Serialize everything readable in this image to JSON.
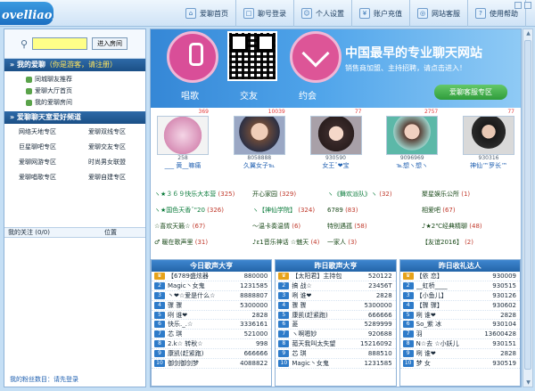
{
  "app": {
    "logo": "ovelliao爱聊"
  },
  "nav": [
    {
      "icon": "home-icon",
      "glyph": "⌂",
      "label": "爱聊首页"
    },
    {
      "icon": "login-icon",
      "glyph": "□",
      "label": "聊号登录"
    },
    {
      "icon": "user-settings-icon",
      "glyph": "☺",
      "label": "个人设置"
    },
    {
      "icon": "recharge-icon",
      "glyph": "¥",
      "label": "账户充值"
    },
    {
      "icon": "support-icon",
      "glyph": "◎",
      "label": "网站客服"
    },
    {
      "icon": "help-icon",
      "glyph": "?",
      "label": "使用帮助"
    }
  ],
  "search": {
    "button": "进入房间",
    "value": ""
  },
  "my_aichat": {
    "title": "我的爱聊",
    "hint": "（你是游客，请注册）",
    "items": [
      "同城聊友推荐",
      "爱聊大厅首页",
      "我的爱聊房间"
    ]
  },
  "channels": {
    "title": "爱聊聊天室爱好频道",
    "items": [
      "网络天地专区",
      "爱聊双线专区",
      "巨星聊吧专区",
      "爱聊交友专区",
      "爱聊网游专区",
      "时尚男女联盟",
      "爱聊唱歌专区",
      "爱聊自建专区"
    ]
  },
  "attention": {
    "label": "我的关注 (0/0)",
    "position": "位置"
  },
  "fans": "我的粉丝数目：请先登录",
  "banner": {
    "title": "中国最早的专业聊天网站",
    "subtitle": "销售商加盟、主持招聘，请点击进入！",
    "labels": [
      "唱歌",
      "交友",
      "约会"
    ],
    "button": "爱聊客服专区"
  },
  "cards": [
    {
      "num": "369",
      "id": "258",
      "nick": "___ 黄__嘛痛"
    },
    {
      "num": "10039",
      "id": "8058888",
      "nick": "久翼女子℡"
    },
    {
      "num": "77",
      "id": "930590",
      "nick": "女王ˇ❤宝"
    },
    {
      "num": "2757",
      "id": "9096969",
      "nick": "℡想ヽ想ヽ"
    },
    {
      "num": "77",
      "id": "930316",
      "nick": "神仙™罗长™"
    }
  ],
  "rooms": [
    {
      "name": "ヽ★３６９快乐大本营",
      "count": "(325)"
    },
    {
      "name": "开心家园",
      "count": "(329)"
    },
    {
      "name": "ヽ《舞欢派队》ヽ",
      "count": "(32)"
    },
    {
      "name": "聚星娱乐公所",
      "count": "(1)"
    },
    {
      "name": "ヽ★国色天香ˇ\"20",
      "count": "(326)"
    },
    {
      "name": "ヽ【神仙学院】",
      "count": "(324)"
    },
    {
      "name": "6789",
      "count": "(83)"
    },
    {
      "name": "相爱吧",
      "count": "(67)"
    },
    {
      "name": "☆喜欢天籁☆",
      "count": "(67)"
    },
    {
      "name": "～温卡奏温情",
      "count": "(6)"
    },
    {
      "name": "特别遇孤",
      "count": "(58)"
    },
    {
      "name": "♪★2℃经典精聊",
      "count": "(48)"
    },
    {
      "name": "♂ 暖在歌声里",
      "count": "(31)"
    },
    {
      "name": "♪ε1音乐神话 ☆魅天",
      "count": "(4)"
    },
    {
      "name": "一家人",
      "count": "(3)"
    },
    {
      "name": "【友谊2016】",
      "count": "(2)"
    }
  ],
  "ranks": [
    {
      "title": "今日歌声大亨",
      "rows": [
        {
          "n": "【6789盛炫器",
          "v": "880000"
        },
        {
          "n": "Magic丶女鬼",
          "v": "1231585"
        },
        {
          "n": "丶❤☆爱是什么☆",
          "v": "8888807"
        },
        {
          "n": "骤 骤",
          "v": "5300000"
        },
        {
          "n": "咧 谁❤",
          "v": "2828"
        },
        {
          "n": "快乐._.☆",
          "v": "3336161"
        },
        {
          "n": "芯 琪",
          "v": "521000"
        },
        {
          "n": "2.k☆ 转秋☆",
          "v": "998"
        },
        {
          "n": "康凯(赶紧跑)",
          "v": "666666"
        },
        {
          "n": "御剑御剑梦",
          "v": "4088822"
        }
      ]
    },
    {
      "title": "昨日歌声大亨",
      "rows": [
        {
          "n": "【太阳君】主持包",
          "v": "520122"
        },
        {
          "n": "搞 战☆",
          "v": "23456T"
        },
        {
          "n": "咧 谁❤",
          "v": "2828"
        },
        {
          "n": "骤 骤",
          "v": "5300000"
        },
        {
          "n": "康凯(赶紧跑)",
          "v": "666666"
        },
        {
          "n": "菱",
          "v": "5289999"
        },
        {
          "n": "ヽ啊嗯妙",
          "v": "920688"
        },
        {
          "n": "菰天我叫太失望",
          "v": "15216092"
        },
        {
          "n": "芯 琪",
          "v": "888510"
        },
        {
          "n": "Magic丶女鬼",
          "v": "1231585"
        }
      ]
    },
    {
      "title": "昨日收礼达人",
      "rows": [
        {
          "n": "【依 恋】",
          "v": "930009"
        },
        {
          "n": "__虹桥____",
          "v": "930515"
        },
        {
          "n": "【小鱼儿】",
          "v": "930126"
        },
        {
          "n": "【骤 骤】",
          "v": "930602"
        },
        {
          "n": "咧 谁❤",
          "v": "2828"
        },
        {
          "n": "So_紫 冰",
          "v": "930104"
        },
        {
          "n": "羽",
          "v": "13600428"
        },
        {
          "n": "N☆去 ☆小妖儿",
          "v": "930151"
        },
        {
          "n": "咧 谁❤",
          "v": "2828"
        },
        {
          "n": "梦 女",
          "v": "930519"
        }
      ]
    }
  ]
}
